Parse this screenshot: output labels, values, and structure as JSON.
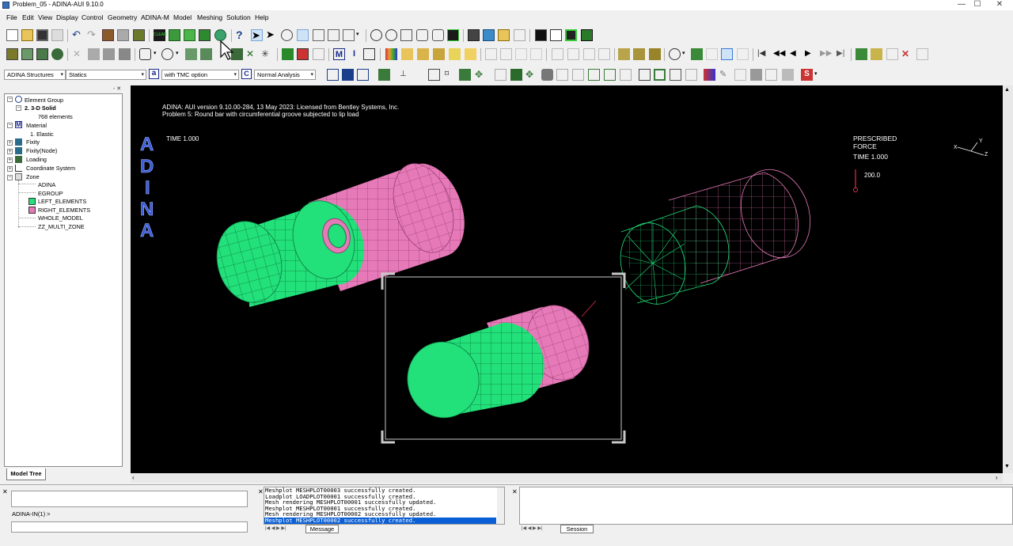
{
  "window": {
    "title": "Problem_05 - ADINA-AUI 9.10.0",
    "minimize": "—",
    "maximize": "☐",
    "close": "✕"
  },
  "menu": [
    "File",
    "Edit",
    "View",
    "Display",
    "Control",
    "Geometry",
    "ADINA-M",
    "Model",
    "Meshing",
    "Solution",
    "Help"
  ],
  "toolbar": {
    "program": "ADINA Structures",
    "analysis": "Statics",
    "tmc_letter": "a",
    "tmc_option": "with TMC option",
    "analysis_letter": "C",
    "analysis_mode": "Normal Analysis"
  },
  "tree": {
    "element_group": "Element Group",
    "element_group_item": "2. 3-D Solid",
    "element_count": "768 elements",
    "material": "Material",
    "material_item": "1. Elastic",
    "fixity": "Fixity",
    "fixity_node": "Fixity(Node)",
    "loading": "Loading",
    "coordinate_system": "Coordinate System",
    "zone": "Zone",
    "zones": [
      "ADINA",
      "EGROUP",
      "LEFT_ELEMENTS",
      "RIGHT_ELEMENTS",
      "WHOLE_MODEL",
      "ZZ_MULTI_ZONE"
    ],
    "tab": "Model Tree"
  },
  "graphics": {
    "header_line1": "ADINA: AUI version 9.10.00-284, 13 May 2023: Licensed from Bentley Systems, Inc.",
    "header_line2": "Problem 5: Round bar with circumferential groove subjected to lip load",
    "logo": [
      "A",
      "D",
      "I",
      "N",
      "A"
    ],
    "time_left": "TIME 1.000",
    "prescribed": "PRESCRIBED",
    "force": "FORCE",
    "time_right": "TIME 1.000",
    "force_value": "200.0",
    "triad_x": "X",
    "triad_y": "Y",
    "triad_z": "Z",
    "colors": {
      "green_fill": "#22e07a",
      "green_line": "#22e07a",
      "pink_fill": "#e67ab8",
      "pink_line": "#e67ab8",
      "background": "#000000",
      "selection_box": "#c8c8c8",
      "force_marker": "#e0304a"
    }
  },
  "bottom": {
    "command_prompt": "ADINA-IN(1) >",
    "messages": [
      "Meshplot MESHPLOT00003 successfully created.",
      "Loadplot LOADPLOT00001 successfully created.",
      "Mesh rendering MESHPLOT00001 successfully updated.",
      " Meshplot MESHPLOT00001 successfully created.",
      "Mesh rendering MESHPLOT00002 successfully updated.",
      " Meshplot MESHPLOT00002 successfully created."
    ],
    "message_tab": "Message",
    "session_tab": "Session"
  }
}
